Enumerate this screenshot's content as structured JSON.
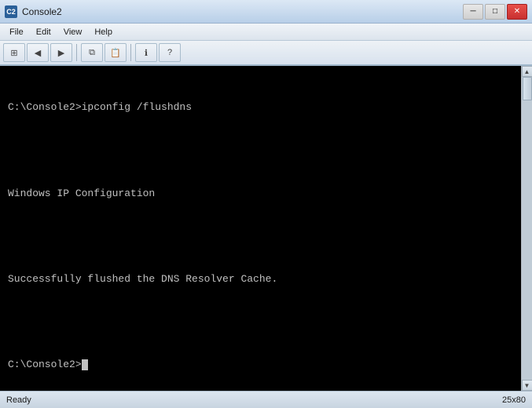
{
  "titlebar": {
    "title": "Console2",
    "app_icon_label": "C2"
  },
  "menubar": {
    "items": [
      {
        "label": "File"
      },
      {
        "label": "Edit"
      },
      {
        "label": "View"
      },
      {
        "label": "Help"
      }
    ]
  },
  "toolbar": {
    "buttons": [
      {
        "icon": "📋",
        "name": "new-tab"
      },
      {
        "icon": "◀",
        "name": "back"
      },
      {
        "icon": "▶",
        "name": "forward"
      },
      {
        "icon": "📄",
        "name": "copy"
      },
      {
        "icon": "📌",
        "name": "paste"
      },
      {
        "icon": "ℹ",
        "name": "info"
      },
      {
        "icon": "❓",
        "name": "help"
      }
    ]
  },
  "terminal": {
    "lines": [
      "C:\\Console2>ipconfig /flushdns",
      "",
      "Windows IP Configuration",
      "",
      "Successfully flushed the DNS Resolver Cache.",
      "",
      "C:\\Console2>"
    ]
  },
  "window_controls": {
    "minimize": "─",
    "maximize": "□",
    "close": "✕"
  },
  "status_bar": {
    "status_text": "Ready",
    "dimensions": "25x80"
  },
  "scrollbar": {
    "arrow_up": "▲",
    "arrow_down": "▼"
  }
}
